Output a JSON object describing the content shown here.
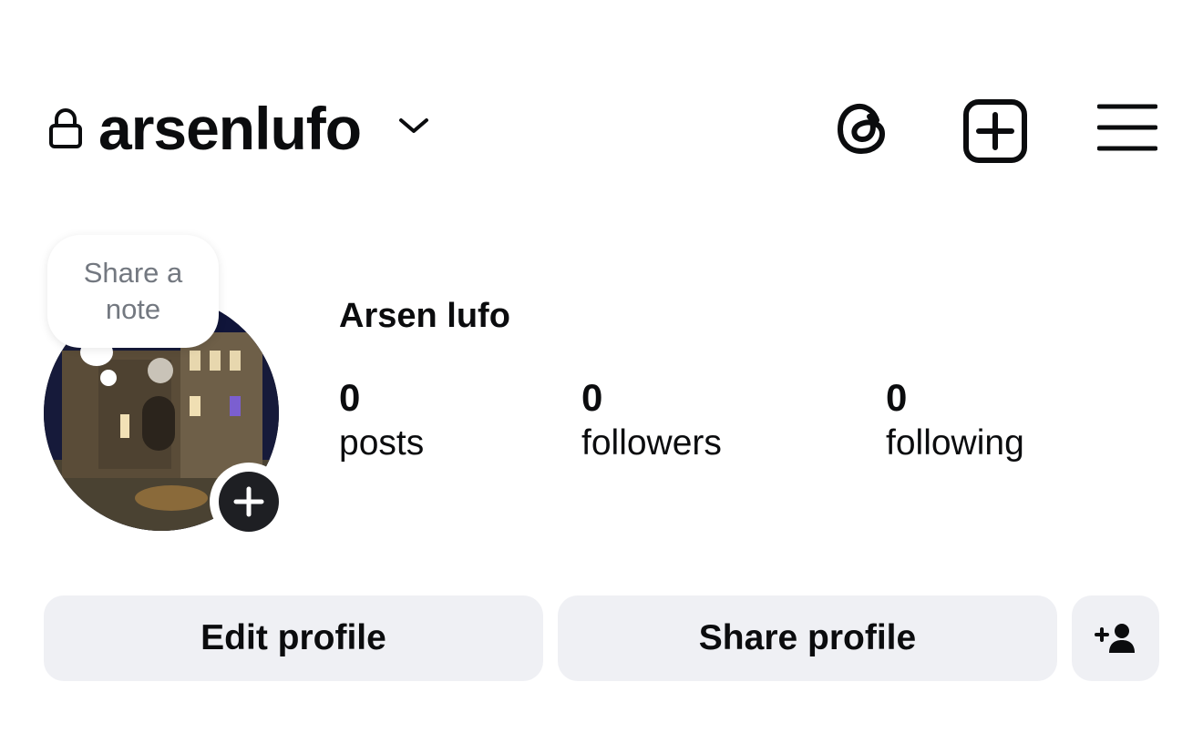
{
  "header": {
    "username": "arsenlufo",
    "icons": {
      "lock": "lock-icon",
      "dropdown": "chevron-down-icon",
      "threads": "threads-icon",
      "create": "plus-square-icon",
      "menu": "hamburger-menu-icon"
    }
  },
  "profile": {
    "note_prompt": "Share a note",
    "display_name": "Arsen lufo",
    "add_story_icon": "plus-icon"
  },
  "stats": [
    {
      "value": "0",
      "label": "posts"
    },
    {
      "value": "0",
      "label": "followers"
    },
    {
      "value": "0",
      "label": "following"
    }
  ],
  "actions": {
    "edit_profile": "Edit profile",
    "share_profile": "Share profile",
    "discover_people_icon": "add-person-icon"
  },
  "colors": {
    "text": "#0b0c0e",
    "muted_text": "#737880",
    "button_bg": "#eff0f4",
    "add_story_bg": "#1e1f23"
  }
}
